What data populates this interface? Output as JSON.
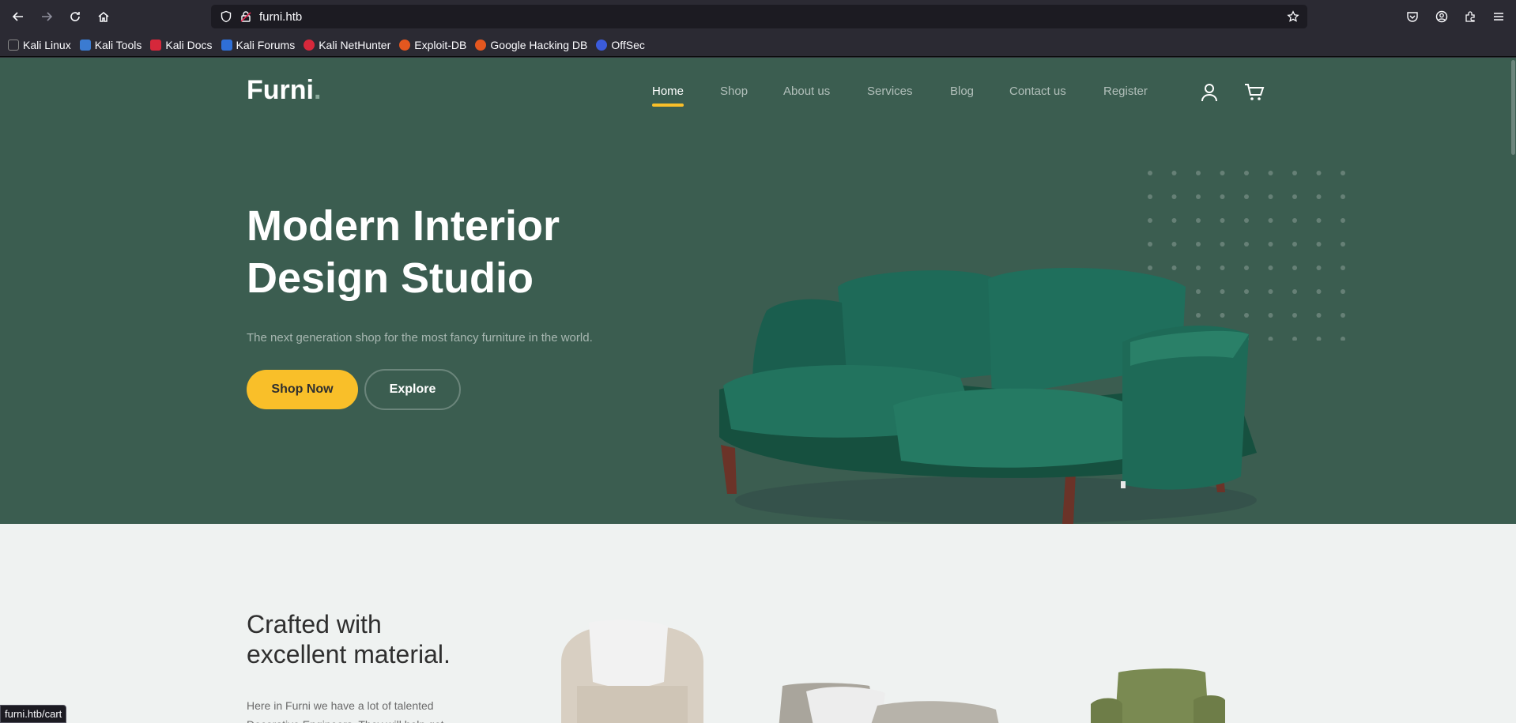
{
  "browser": {
    "url": "furni.htb",
    "bookmarks": [
      {
        "label": "Kali Linux",
        "color": "#1f1f1f"
      },
      {
        "label": "Kali Tools",
        "color": "#3b7bd1"
      },
      {
        "label": "Kali Docs",
        "color": "#d6283b"
      },
      {
        "label": "Kali Forums",
        "color": "#2f6fd6"
      },
      {
        "label": "Kali NetHunter",
        "color": "#d6283b"
      },
      {
        "label": "Exploit-DB",
        "color": "#e4571f"
      },
      {
        "label": "Google Hacking DB",
        "color": "#e4571f"
      },
      {
        "label": "OffSec",
        "color": "#3b5bdb"
      }
    ],
    "status_url": "furni.htb/cart"
  },
  "site": {
    "brand": "Furni",
    "brand_dot": ".",
    "nav": [
      "Home",
      "Shop",
      "About us",
      "Services",
      "Blog",
      "Contact us",
      "Register"
    ],
    "active_nav": "Home",
    "colors": {
      "hero_bg": "#3b5d50",
      "accent": "#f9bf29"
    }
  },
  "hero": {
    "title_line1": "Modern Interior",
    "title_line2": "Design Studio",
    "subtitle": "The next generation shop for the most fancy furniture in the world.",
    "shop_button": "Shop Now",
    "explore_button": "Explore"
  },
  "section": {
    "title_line1": "Crafted with",
    "title_line2": "excellent material.",
    "text_line1": "Here in Furni we have a lot of talented",
    "text_line2": "Decorative Engineers. They will help get"
  }
}
